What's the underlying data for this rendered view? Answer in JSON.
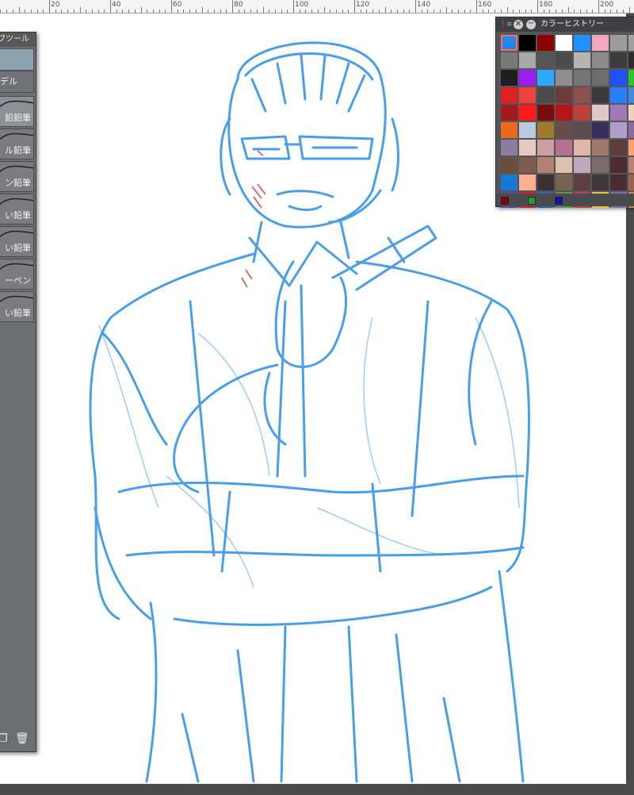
{
  "ruler": {
    "labels": [
      "20",
      "40",
      "60",
      "80",
      "100",
      "120",
      "140",
      "160",
      "180",
      "200"
    ]
  },
  "subtool_panel": {
    "title": "ブツール",
    "group_label": "デル",
    "items": [
      {
        "label": "鉛鉛筆"
      },
      {
        "label": "ル鉛筆"
      },
      {
        "label": "ン鉛筆"
      },
      {
        "label": "い鉛筆"
      },
      {
        "label": "い鉛筆"
      },
      {
        "label": "ーペン"
      },
      {
        "label": "い鉛筆"
      }
    ],
    "buttons": [
      "copy-subtool-icon",
      "trash-icon"
    ]
  },
  "color_history": {
    "title": "カラーヒストリー",
    "selected_color": "#2288e8",
    "rows": [
      [
        "#2288e8",
        "#000000",
        "#8b0000",
        "#ffffff",
        "#1e90ff",
        "#f3a6c0",
        "#9c9c9c",
        "#a0a0a0"
      ],
      [
        "#7a7a7a",
        "#a8a8a8",
        "#555555",
        "#4b4b4b",
        "#b4b4b4",
        "#8a8a8a",
        "#3c3c3c",
        "#2b2b2b"
      ],
      [
        "#1f1f1f",
        "#9b20f0",
        "#2ea7ff",
        "#8e8e8e",
        "#757575",
        "#6d6d6d",
        "#2050ff",
        "#2dc52d"
      ],
      [
        "#e02020",
        "#f04040",
        "#4a4a4a",
        "#6f3b3b",
        "#8f5050",
        "#3a3a3a",
        "#2a7fff",
        "#3d8ee0"
      ],
      [
        "#9e1c1c",
        "#ff1a1a",
        "#7a0c0c",
        "#b51515",
        "#c0403a",
        "#e0c7c7",
        "#a07ab8",
        "#f0d0c0"
      ],
      [
        "#e86a1a",
        "#b9c9e0",
        "#a07a2c",
        "#6a4a4a",
        "#5c4c50",
        "#3c2c5c",
        "#b0a0c8",
        "#8a6a9a"
      ],
      [
        "#8c7ca0",
        "#e8c8c0",
        "#c8a0a0",
        "#b87090",
        "#e0b8a8",
        "#a07870",
        "#5c3c3c",
        "#ffa070"
      ],
      [
        "#6c4c3c",
        "#7c5c4c",
        "#b08070",
        "#dcc0b0",
        "#c0a8b8",
        "#7c6c6c",
        "#4c2c2c",
        "#b88070"
      ],
      [
        "#1878d8",
        "#ffb090",
        "#3c3030",
        "#7c6050",
        "#5c4040",
        "#403838",
        "#483030",
        "#a06050"
      ],
      [
        "#5a4aa0",
        "#c82040",
        "#3060c0",
        "#50a050",
        "#c04040",
        "#f0c040",
        "#8070b0",
        "#d08040"
      ]
    ],
    "footer_swatches": [
      "#8b0000",
      "#20a020",
      "#1010c0"
    ]
  },
  "canvas": {
    "stroke_color": "#2a8ee6",
    "accent_color": "#c04040"
  }
}
